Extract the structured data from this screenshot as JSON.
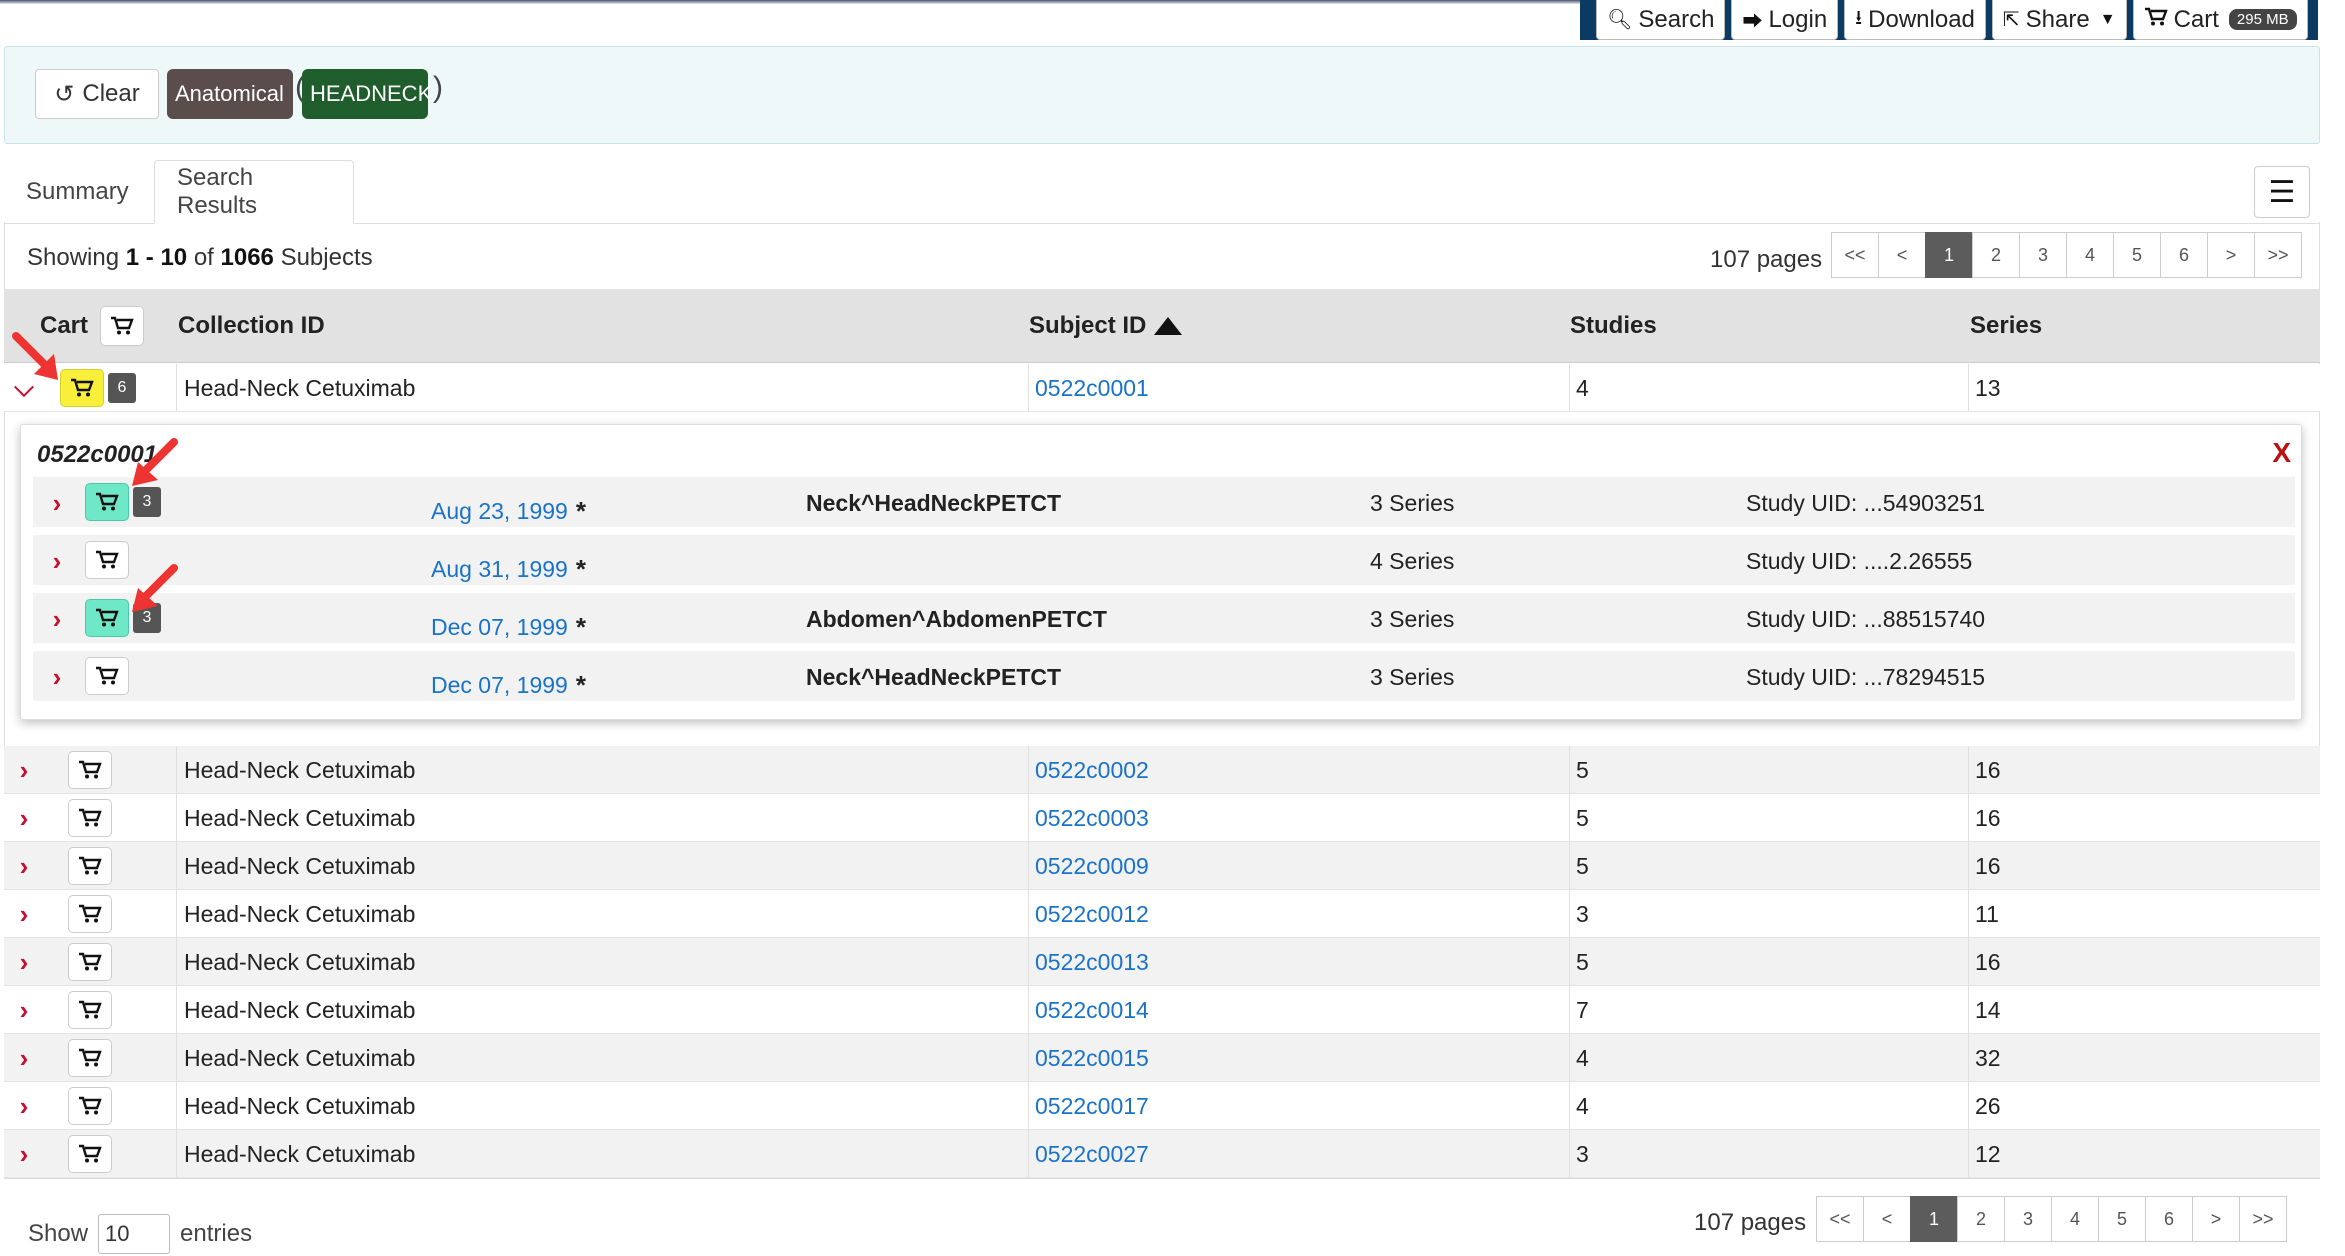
{
  "nav": {
    "search": "Search",
    "login": "Login",
    "download": "Download",
    "share": "Share",
    "cart": "Cart",
    "cart_size": "295 MB"
  },
  "query": {
    "clear_label": "Clear",
    "open_paren": "(",
    "close_paren": ")",
    "tags": [
      "Anatomical",
      "HEADNECK"
    ]
  },
  "tabs": {
    "summary": "Summary",
    "results": "Search Results"
  },
  "results": {
    "showing_prefix": "Showing",
    "range_start": "1",
    "range_sep": "-",
    "range_end": "10",
    "of": "of",
    "total": "1066",
    "unit": "Subjects",
    "pages": "107 pages"
  },
  "pager": {
    "first": "<<",
    "prev": "<",
    "pages": [
      "1",
      "2",
      "3",
      "4",
      "5",
      "6"
    ],
    "next": ">",
    "last": ">>"
  },
  "table": {
    "headers": {
      "cart": "Cart",
      "collection": "Collection ID",
      "subject": "Subject ID",
      "studies": "Studies",
      "series": "Series"
    },
    "rows": [
      {
        "collection": "Head-Neck Cetuximab",
        "subject": "0522c0001",
        "studies": "4",
        "series": "13",
        "count": "6"
      },
      {
        "collection": "Head-Neck Cetuximab",
        "subject": "0522c0002",
        "studies": "5",
        "series": "16"
      },
      {
        "collection": "Head-Neck Cetuximab",
        "subject": "0522c0003",
        "studies": "5",
        "series": "16"
      },
      {
        "collection": "Head-Neck Cetuximab",
        "subject": "0522c0009",
        "studies": "5",
        "series": "16"
      },
      {
        "collection": "Head-Neck Cetuximab",
        "subject": "0522c0012",
        "studies": "3",
        "series": "11"
      },
      {
        "collection": "Head-Neck Cetuximab",
        "subject": "0522c0013",
        "studies": "5",
        "series": "16"
      },
      {
        "collection": "Head-Neck Cetuximab",
        "subject": "0522c0014",
        "studies": "7",
        "series": "14"
      },
      {
        "collection": "Head-Neck Cetuximab",
        "subject": "0522c0015",
        "studies": "4",
        "series": "32"
      },
      {
        "collection": "Head-Neck Cetuximab",
        "subject": "0522c0017",
        "studies": "4",
        "series": "26"
      },
      {
        "collection": "Head-Neck Cetuximab",
        "subject": "0522c0027",
        "studies": "3",
        "series": "12"
      }
    ]
  },
  "panel": {
    "title": "0522c0001",
    "close": "X",
    "star": "*",
    "studies": [
      {
        "date": "Aug 23, 1999",
        "desc": "Neck^HeadNeckPETCT",
        "series": "3 Series",
        "uid": "Study UID: ...54903251",
        "count": "3"
      },
      {
        "date": "Aug 31, 1999",
        "desc": "",
        "series": "4 Series",
        "uid": "Study UID: ....2.26555"
      },
      {
        "date": "Dec 07, 1999",
        "desc": "Abdomen^AbdomenPETCT",
        "series": "3 Series",
        "uid": "Study UID: ...88515740",
        "count": "3"
      },
      {
        "date": "Dec 07, 1999",
        "desc": "Neck^HeadNeckPETCT",
        "series": "3 Series",
        "uid": "Study UID: ...78294515"
      }
    ]
  },
  "footer": {
    "show": "Show",
    "entries_value": "10",
    "entries": "entries"
  },
  "colors": {
    "link": "#1a73c8",
    "chevron": "#c8102e",
    "cart_added": "#f7ef3a",
    "cart_partial": "#6ee8c6",
    "tag_anatomical": "#5a4d4c",
    "tag_headneck": "#1f5d2c"
  }
}
